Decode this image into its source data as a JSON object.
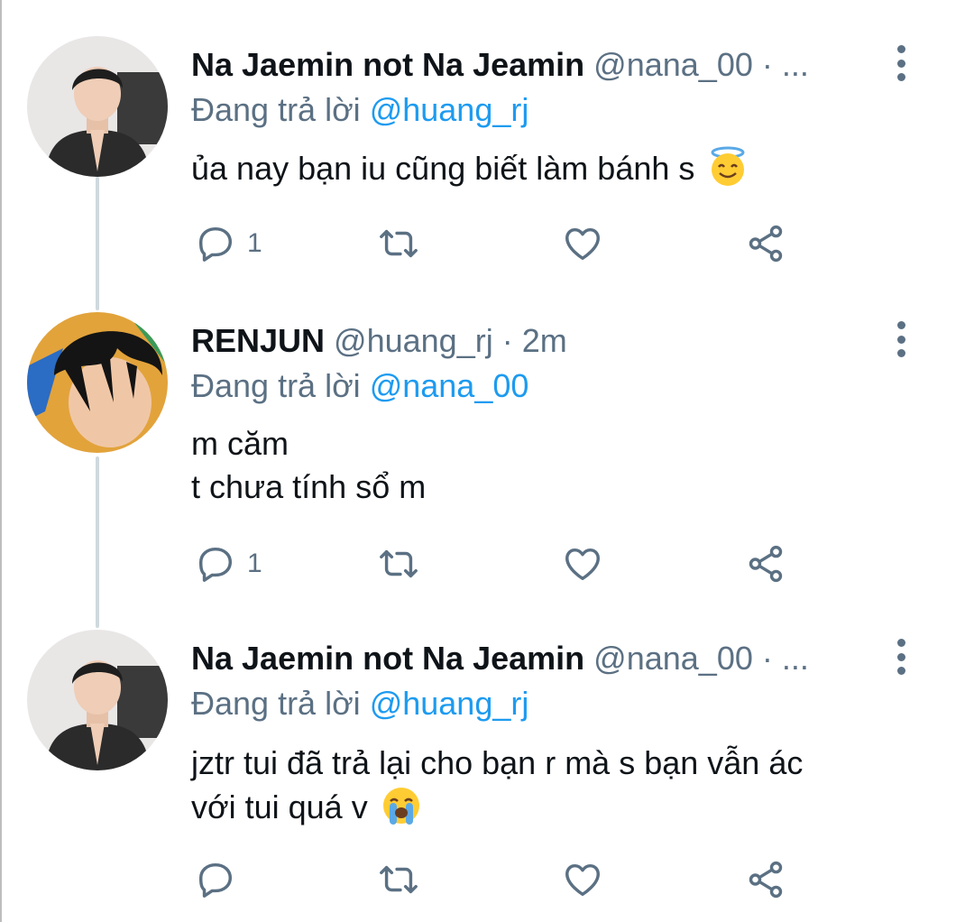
{
  "colors": {
    "handle": "#5b7083",
    "mention": "#1d9bf0",
    "icon": "#5b7083",
    "thread_line": "#cfd9de"
  },
  "tweets": [
    {
      "name": "Na Jaemin not Na Jeamin",
      "handle": "@nana_00",
      "separator": "·",
      "time": "...",
      "replying_prefix": "Đang trả lời ",
      "replying_to": "@huang_rj",
      "lines": [
        "ủa nay bạn iu cũng biết làm bánh s"
      ],
      "emoji": "smiling-face-with-halo-emoji",
      "reply_count": "1"
    },
    {
      "name": "RENJUN",
      "handle": "@huang_rj",
      "separator": "·",
      "time": "2m",
      "replying_prefix": "Đang trả lời ",
      "replying_to": "@nana_00",
      "lines": [
        "m căm",
        "t chưa tính sổ m"
      ],
      "reply_count": "1"
    },
    {
      "name": "Na Jaemin not Na Jeamin",
      "handle": "@nana_00",
      "separator": "·",
      "time": "...",
      "replying_prefix": "Đang trả lời ",
      "replying_to": "@huang_rj",
      "lines": [
        "jztr tui đã trả lại cho bạn r mà s bạn vẫn ác",
        "với tui quá v"
      ],
      "emoji": "loudly-crying-face-emoji",
      "reply_count": ""
    }
  ]
}
